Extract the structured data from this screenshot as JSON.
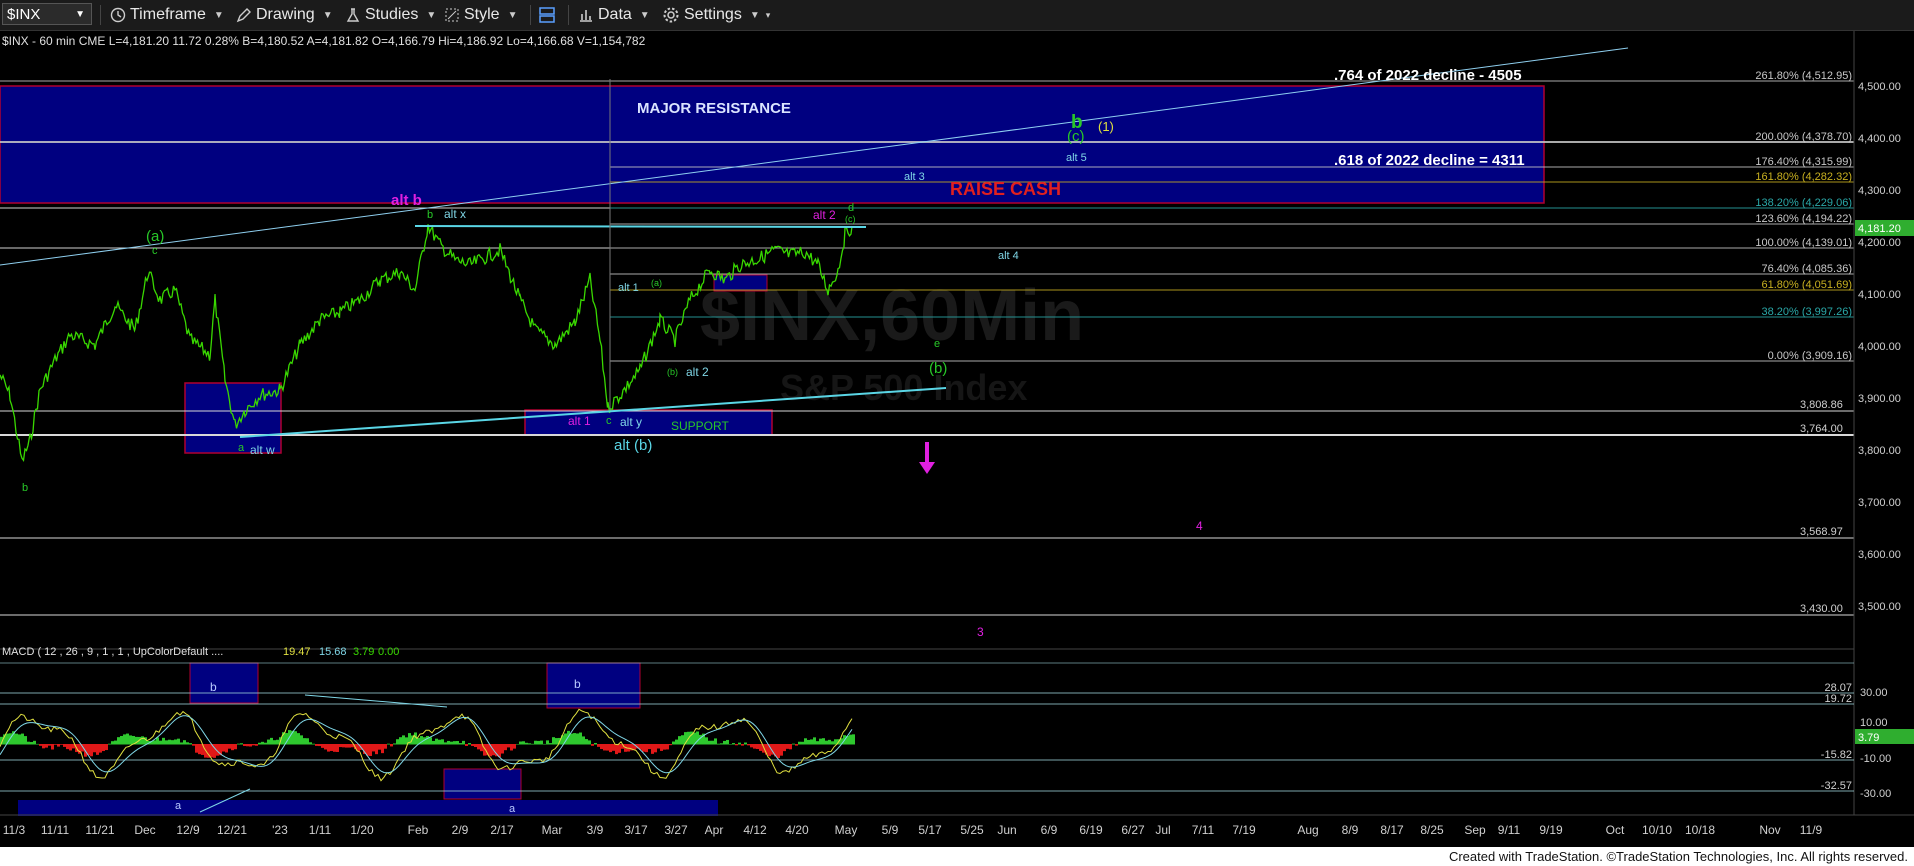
{
  "toolbar": {
    "symbol": "$INX",
    "timeframe": "Timeframe",
    "drawing": "Drawing",
    "studies": "Studies",
    "style": "Style",
    "data": "Data",
    "settings": "Settings"
  },
  "quote_line": "$INX - 60 min  CME  L=4,181.20  11.72  0.28%  B=4,180.52  A=4,181.82  O=4,166.79  Hi=4,186.92  Lo=4,166.68  V=1,154,782",
  "price_axis": {
    "ticks": [
      "4,500.00",
      "4,400.00",
      "4,300.00",
      "4,200.00",
      "4,100.00",
      "4,000.00",
      "3,900.00",
      "3,800.00",
      "3,700.00",
      "3,600.00",
      "3,500.00"
    ],
    "last_price": "4,181.20",
    "level_labels": [
      "3,808.86",
      "3,764.00",
      "3,568.97",
      "3,430.00"
    ]
  },
  "fib_labels": [
    {
      "text": "261.80% (4,512.95)",
      "color": "#c8c8c8"
    },
    {
      "text": "200.00% (4,378.70)",
      "color": "#c8c8c8"
    },
    {
      "text": "176.40% (4,315.99)",
      "color": "#c8c8c8"
    },
    {
      "text": "161.80% (4,282.32)",
      "color": "#c8b020"
    },
    {
      "text": "138.20% (4,229.06)",
      "color": "#2aa8a8"
    },
    {
      "text": "123.60% (4,194.22)",
      "color": "#c8c8c8"
    },
    {
      "text": "100.00% (4,139.01)",
      "color": "#c8c8c8"
    },
    {
      "text": "76.40% (4,085.36)",
      "color": "#c8c8c8"
    },
    {
      "text": "61.80% (4,051.69)",
      "color": "#c8b020"
    },
    {
      "text": "38.20% (3,997.26)",
      "color": "#2aa8a8"
    },
    {
      "text": "0.00% (3,909.16)",
      "color": "#c8c8c8"
    }
  ],
  "annotations": {
    "major_resistance": "MAJOR RESISTANCE",
    "raise_cash": "RAISE CASH",
    "decline_764": ".764 of 2022 decline - 4505",
    "decline_618": ".618 of 2022 decline = 4311",
    "support": "SUPPORT",
    "alt_b": "alt b",
    "alt_x": "alt x",
    "alt_w": "alt w",
    "alt_y": "alt y",
    "alt_1_magenta": "alt 1",
    "alt_1_cyan": "alt 1",
    "alt_2_magenta": "alt 2",
    "alt_2_cyan": "alt 2",
    "alt_3": "alt 3",
    "alt_4": "alt 4",
    "alt_5": "alt 5",
    "alt_paren_b": "alt (b)",
    "paren_a": "(a)",
    "paren_b": "(b)",
    "paren_c": "(c)",
    "paren_1": "(1)",
    "big_b": "b",
    "small_a": "a",
    "small_b": "b",
    "small_c": "c",
    "small_d": "d",
    "small_e": "e",
    "small_paren_a": "(a)",
    "small_paren_b": "(b)",
    "small_paren_c": "(c)",
    "wave_3": "3",
    "wave_4": "4",
    "watermark": "$INX,60Min",
    "watermark_sub": "S&P 500 Index"
  },
  "macd": {
    "header": "MACD ( 12 , 26 , 9 , 1 , 1 , UpColorDefault ....",
    "v1": "19.47",
    "v2": "15.68",
    "v3": "3.79",
    "v4": "0.00",
    "axis_ticks": [
      "30.00",
      "10.00",
      "-10.00",
      "-30.00"
    ],
    "level_labels": [
      "28.07",
      "19.72",
      "-15.82",
      "-32.57"
    ],
    "current": "3.79",
    "box_labels": [
      "b",
      "b",
      "a",
      "a"
    ]
  },
  "time_axis": [
    "11/3",
    "11/11",
    "11/21",
    "Dec",
    "12/9",
    "12/21",
    "'23",
    "1/11",
    "1/20",
    "Feb",
    "2/9",
    "2/17",
    "Mar",
    "3/9",
    "3/17",
    "3/27",
    "Apr",
    "4/12",
    "4/20",
    "May",
    "5/9",
    "5/17",
    "5/25",
    "Jun",
    "6/9",
    "6/19",
    "6/27",
    "Jul",
    "7/11",
    "7/19",
    "Aug",
    "8/9",
    "8/17",
    "8/25",
    "Sep",
    "9/11",
    "9/19",
    "Oct",
    "10/10",
    "10/18",
    "Nov",
    "11/9"
  ],
  "footer": "Created with TradeStation. ©TradeStation Technologies, Inc. All rights reserved.",
  "colors": {
    "background": "#000000",
    "price": "#39d800",
    "box_fill": "#000080",
    "box_border": "#b00030",
    "cyan_line": "#7fd6e6",
    "magenta": "#e020e0",
    "green_label": "#28c828"
  }
}
